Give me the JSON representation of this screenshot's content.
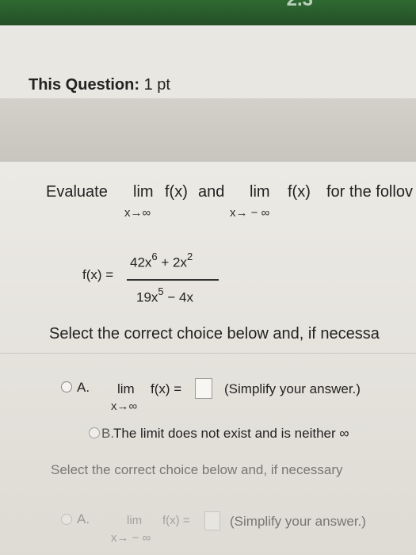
{
  "header": {
    "top_fragment": "2.3",
    "label": "This Question:",
    "points": "1 pt"
  },
  "question": {
    "evaluate": "Evaluate",
    "lim1": "lim",
    "lim1_sub": "x→∞",
    "fx": "f(x)",
    "and": "and",
    "lim2": "lim",
    "lim2_sub": "x→ − ∞",
    "fx2": "f(x)",
    "tail": "for the follov"
  },
  "function": {
    "lhs": "f(x) =",
    "num_a": "42x",
    "num_a_exp": "6",
    "num_op": "+ 2x",
    "num_b_exp": "2",
    "den_a": "19x",
    "den_a_exp": "5",
    "den_op": "− 4x"
  },
  "instruction1": "Select the correct choice below and, if necessa",
  "choiceA": {
    "letter": "A.",
    "lim": "lim",
    "fx": "f(x) =",
    "sub": "x→∞",
    "hint": "(Simplify your answer.)"
  },
  "choiceB": {
    "letter": "B.",
    "text": "The limit does not exist and is neither ∞"
  },
  "instruction2": "Select the correct choice below and, if necessary",
  "choiceA2": {
    "letter": "A.",
    "lim": "lim",
    "fx": "f(x) =",
    "sub": "x→ − ∞",
    "hint": "(Simplify your answer.)"
  }
}
